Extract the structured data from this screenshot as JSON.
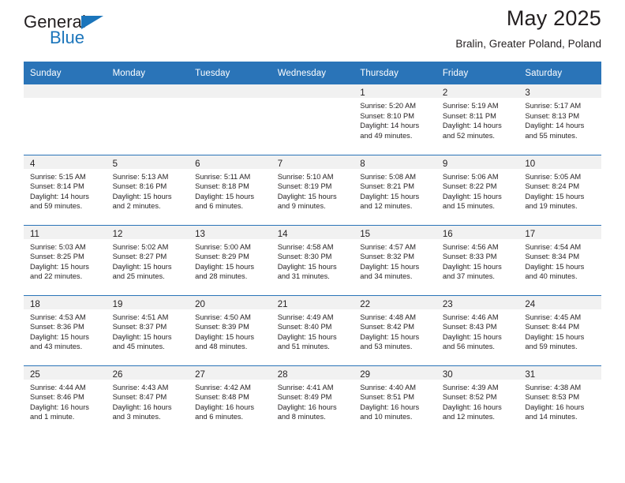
{
  "brand": {
    "name_dark": "General",
    "name_blue": "Blue",
    "accent_color": "#1b75bb",
    "header_color": "#2a74b8",
    "daynum_band_color": "#f1f1f1"
  },
  "header": {
    "title": "May 2025",
    "subtitle": "Bralin, Greater Poland, Poland"
  },
  "weekday_headers": [
    "Sunday",
    "Monday",
    "Tuesday",
    "Wednesday",
    "Thursday",
    "Friday",
    "Saturday"
  ],
  "weeks": [
    [
      {
        "day": "",
        "info": ""
      },
      {
        "day": "",
        "info": ""
      },
      {
        "day": "",
        "info": ""
      },
      {
        "day": "",
        "info": ""
      },
      {
        "day": "1",
        "info": "Sunrise: 5:20 AM\nSunset: 8:10 PM\nDaylight: 14 hours\nand 49 minutes."
      },
      {
        "day": "2",
        "info": "Sunrise: 5:19 AM\nSunset: 8:11 PM\nDaylight: 14 hours\nand 52 minutes."
      },
      {
        "day": "3",
        "info": "Sunrise: 5:17 AM\nSunset: 8:13 PM\nDaylight: 14 hours\nand 55 minutes."
      }
    ],
    [
      {
        "day": "4",
        "info": "Sunrise: 5:15 AM\nSunset: 8:14 PM\nDaylight: 14 hours\nand 59 minutes."
      },
      {
        "day": "5",
        "info": "Sunrise: 5:13 AM\nSunset: 8:16 PM\nDaylight: 15 hours\nand 2 minutes."
      },
      {
        "day": "6",
        "info": "Sunrise: 5:11 AM\nSunset: 8:18 PM\nDaylight: 15 hours\nand 6 minutes."
      },
      {
        "day": "7",
        "info": "Sunrise: 5:10 AM\nSunset: 8:19 PM\nDaylight: 15 hours\nand 9 minutes."
      },
      {
        "day": "8",
        "info": "Sunrise: 5:08 AM\nSunset: 8:21 PM\nDaylight: 15 hours\nand 12 minutes."
      },
      {
        "day": "9",
        "info": "Sunrise: 5:06 AM\nSunset: 8:22 PM\nDaylight: 15 hours\nand 15 minutes."
      },
      {
        "day": "10",
        "info": "Sunrise: 5:05 AM\nSunset: 8:24 PM\nDaylight: 15 hours\nand 19 minutes."
      }
    ],
    [
      {
        "day": "11",
        "info": "Sunrise: 5:03 AM\nSunset: 8:25 PM\nDaylight: 15 hours\nand 22 minutes."
      },
      {
        "day": "12",
        "info": "Sunrise: 5:02 AM\nSunset: 8:27 PM\nDaylight: 15 hours\nand 25 minutes."
      },
      {
        "day": "13",
        "info": "Sunrise: 5:00 AM\nSunset: 8:29 PM\nDaylight: 15 hours\nand 28 minutes."
      },
      {
        "day": "14",
        "info": "Sunrise: 4:58 AM\nSunset: 8:30 PM\nDaylight: 15 hours\nand 31 minutes."
      },
      {
        "day": "15",
        "info": "Sunrise: 4:57 AM\nSunset: 8:32 PM\nDaylight: 15 hours\nand 34 minutes."
      },
      {
        "day": "16",
        "info": "Sunrise: 4:56 AM\nSunset: 8:33 PM\nDaylight: 15 hours\nand 37 minutes."
      },
      {
        "day": "17",
        "info": "Sunrise: 4:54 AM\nSunset: 8:34 PM\nDaylight: 15 hours\nand 40 minutes."
      }
    ],
    [
      {
        "day": "18",
        "info": "Sunrise: 4:53 AM\nSunset: 8:36 PM\nDaylight: 15 hours\nand 43 minutes."
      },
      {
        "day": "19",
        "info": "Sunrise: 4:51 AM\nSunset: 8:37 PM\nDaylight: 15 hours\nand 45 minutes."
      },
      {
        "day": "20",
        "info": "Sunrise: 4:50 AM\nSunset: 8:39 PM\nDaylight: 15 hours\nand 48 minutes."
      },
      {
        "day": "21",
        "info": "Sunrise: 4:49 AM\nSunset: 8:40 PM\nDaylight: 15 hours\nand 51 minutes."
      },
      {
        "day": "22",
        "info": "Sunrise: 4:48 AM\nSunset: 8:42 PM\nDaylight: 15 hours\nand 53 minutes."
      },
      {
        "day": "23",
        "info": "Sunrise: 4:46 AM\nSunset: 8:43 PM\nDaylight: 15 hours\nand 56 minutes."
      },
      {
        "day": "24",
        "info": "Sunrise: 4:45 AM\nSunset: 8:44 PM\nDaylight: 15 hours\nand 59 minutes."
      }
    ],
    [
      {
        "day": "25",
        "info": "Sunrise: 4:44 AM\nSunset: 8:46 PM\nDaylight: 16 hours\nand 1 minute."
      },
      {
        "day": "26",
        "info": "Sunrise: 4:43 AM\nSunset: 8:47 PM\nDaylight: 16 hours\nand 3 minutes."
      },
      {
        "day": "27",
        "info": "Sunrise: 4:42 AM\nSunset: 8:48 PM\nDaylight: 16 hours\nand 6 minutes."
      },
      {
        "day": "28",
        "info": "Sunrise: 4:41 AM\nSunset: 8:49 PM\nDaylight: 16 hours\nand 8 minutes."
      },
      {
        "day": "29",
        "info": "Sunrise: 4:40 AM\nSunset: 8:51 PM\nDaylight: 16 hours\nand 10 minutes."
      },
      {
        "day": "30",
        "info": "Sunrise: 4:39 AM\nSunset: 8:52 PM\nDaylight: 16 hours\nand 12 minutes."
      },
      {
        "day": "31",
        "info": "Sunrise: 4:38 AM\nSunset: 8:53 PM\nDaylight: 16 hours\nand 14 minutes."
      }
    ]
  ]
}
